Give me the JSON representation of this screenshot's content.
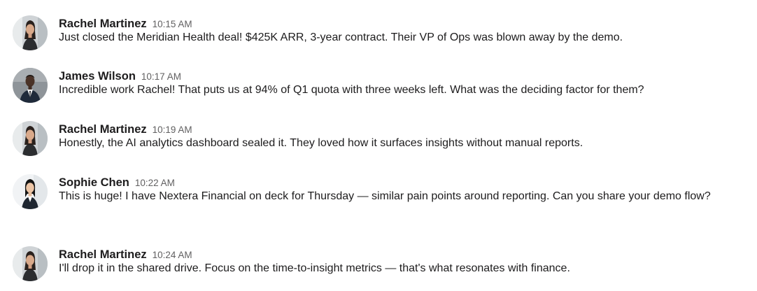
{
  "messages": [
    {
      "author": "Rachel Martinez",
      "time": "10:15 AM",
      "text": "Just closed the Meridian Health deal! $425K ARR, 3-year contract. Their VP of Ops was blown away by the demo."
    },
    {
      "author": "James Wilson",
      "time": "10:17 AM",
      "text": "Incredible work Rachel! That puts us at 94% of Q1 quota with three weeks left. What was the deciding factor for them?"
    },
    {
      "author": "Rachel Martinez",
      "time": "10:19 AM",
      "text": "Honestly, the AI analytics dashboard sealed it. They loved how it surfaces insights without manual reports."
    },
    {
      "author": "Sophie Chen",
      "time": "10:22 AM",
      "text": "This is huge! I have Nextera Financial on deck for Thursday — similar pain points around reporting. Can you share your demo flow?"
    },
    {
      "author": "Rachel Martinez",
      "time": "10:24 AM",
      "text": "I'll drop it in the shared drive. Focus on the time-to-insight metrics — that's what resonates with finance."
    }
  ]
}
